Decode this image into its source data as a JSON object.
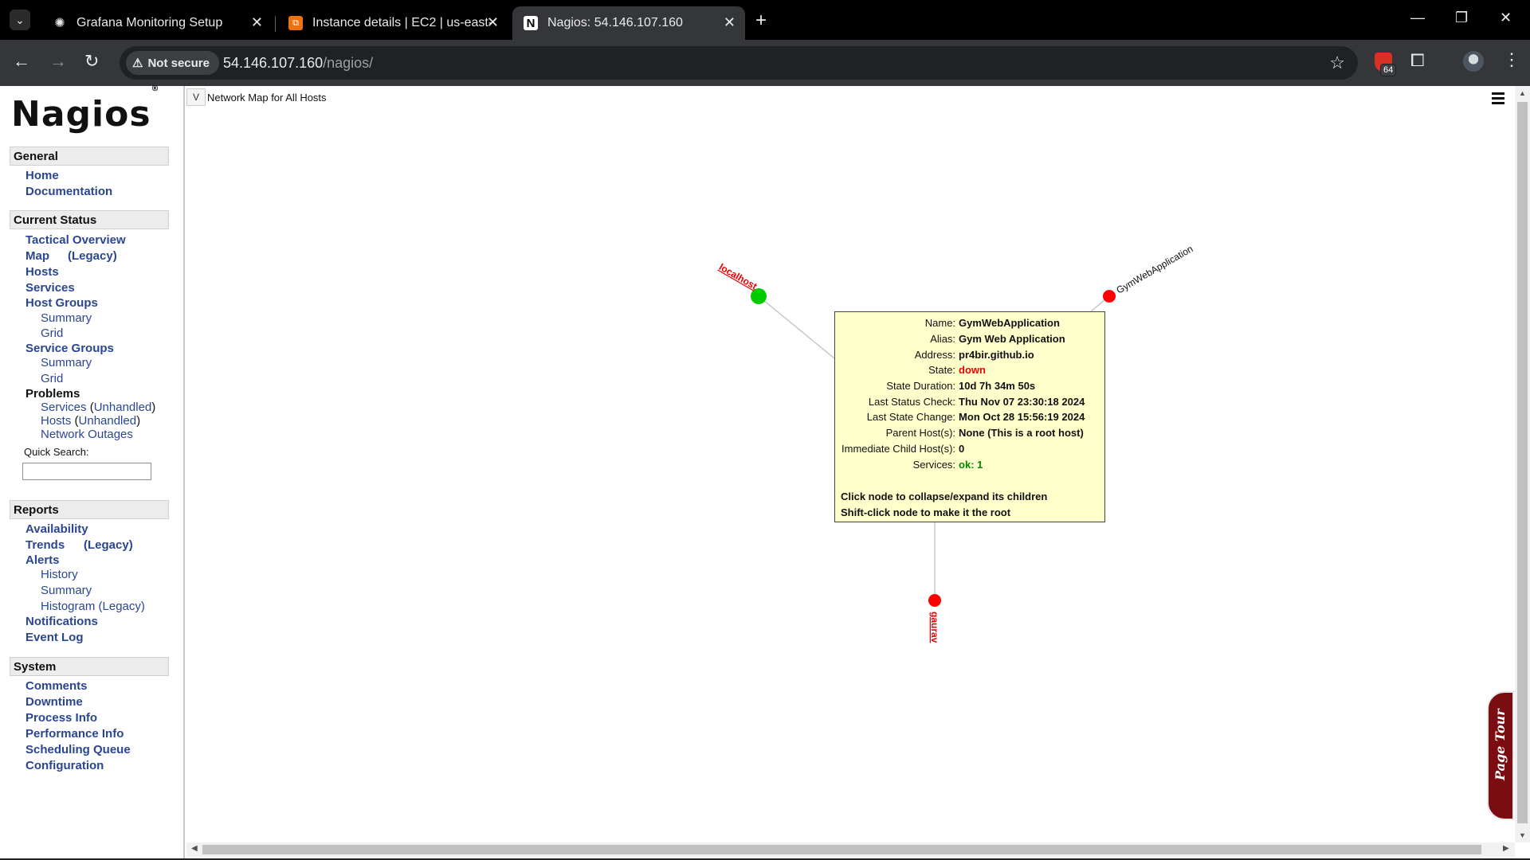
{
  "browser": {
    "tabs": [
      {
        "title": "Grafana Monitoring Setup",
        "icon": "openai-icon"
      },
      {
        "title": "Instance details | EC2 | us-east-",
        "icon": "aws-icon"
      },
      {
        "title": "Nagios: 54.146.107.160",
        "icon": "nagios-icon"
      }
    ],
    "security_label": "Not secure",
    "url_host": "54.146.107.160",
    "url_path": "/nagios/",
    "extension_badge": "64"
  },
  "sidebar": {
    "logo": "Nagios",
    "logo_mark": "®",
    "general": {
      "header": "General",
      "home": "Home",
      "documentation": "Documentation"
    },
    "current_status": {
      "header": "Current Status",
      "tactical_overview": "Tactical Overview",
      "map": "Map",
      "map_legacy": "(Legacy)",
      "hosts": "Hosts",
      "services": "Services",
      "host_groups": "Host Groups",
      "hg_summary": "Summary",
      "hg_grid": "Grid",
      "service_groups": "Service Groups",
      "sg_summary": "Summary",
      "sg_grid": "Grid",
      "problems": "Problems",
      "prob_services": "Services",
      "prob_services_unhandled": "Unhandled",
      "prob_hosts": "Hosts",
      "prob_hosts_unhandled": "Unhandled",
      "network_outages": "Network Outages",
      "quick_search_label": "Quick Search:"
    },
    "reports": {
      "header": "Reports",
      "availability": "Availability",
      "trends": "Trends",
      "trends_legacy": "(Legacy)",
      "alerts": "Alerts",
      "history": "History",
      "summary": "Summary",
      "histogram": "Histogram (Legacy)",
      "notifications": "Notifications",
      "event_log": "Event Log"
    },
    "system": {
      "header": "System",
      "comments": "Comments",
      "downtime": "Downtime",
      "process_info": "Process Info",
      "performance_info": "Performance Info",
      "scheduling_queue": "Scheduling Queue",
      "configuration": "Configuration"
    }
  },
  "map": {
    "v_button": "V",
    "title": "Network Map for All Hosts",
    "hosts": [
      {
        "name": "localhost",
        "state": "up",
        "color": "#00cc00"
      },
      {
        "name": "GymWebApplication",
        "state": "down",
        "color": "#ff0000"
      },
      {
        "name": "gaurav",
        "state": "down",
        "color": "#ff0000"
      }
    ],
    "popup": {
      "rows": [
        {
          "key": "Name:",
          "value": "GymWebApplication"
        },
        {
          "key": "Alias:",
          "value": "Gym Web Application"
        },
        {
          "key": "Address:",
          "value": "pr4bir.github.io"
        },
        {
          "key": "State:",
          "value": "down"
        },
        {
          "key": "State Duration:",
          "value": "10d 7h 34m 50s"
        },
        {
          "key": "Last Status Check:",
          "value": "Thu Nov 07 23:30:18 2024"
        },
        {
          "key": "Last State Change:",
          "value": "Mon Oct 28 15:56:19 2024"
        },
        {
          "key": "Parent Host(s):",
          "value": "None (This is a root host)"
        },
        {
          "key": "Immediate Child Host(s):",
          "value": "0"
        },
        {
          "key": "Services:",
          "value": "ok: 1"
        }
      ],
      "hint1": "Click node to collapse/expand its children",
      "hint2": "Shift-click node to make it the root"
    }
  },
  "page_tour": "Page Tour"
}
